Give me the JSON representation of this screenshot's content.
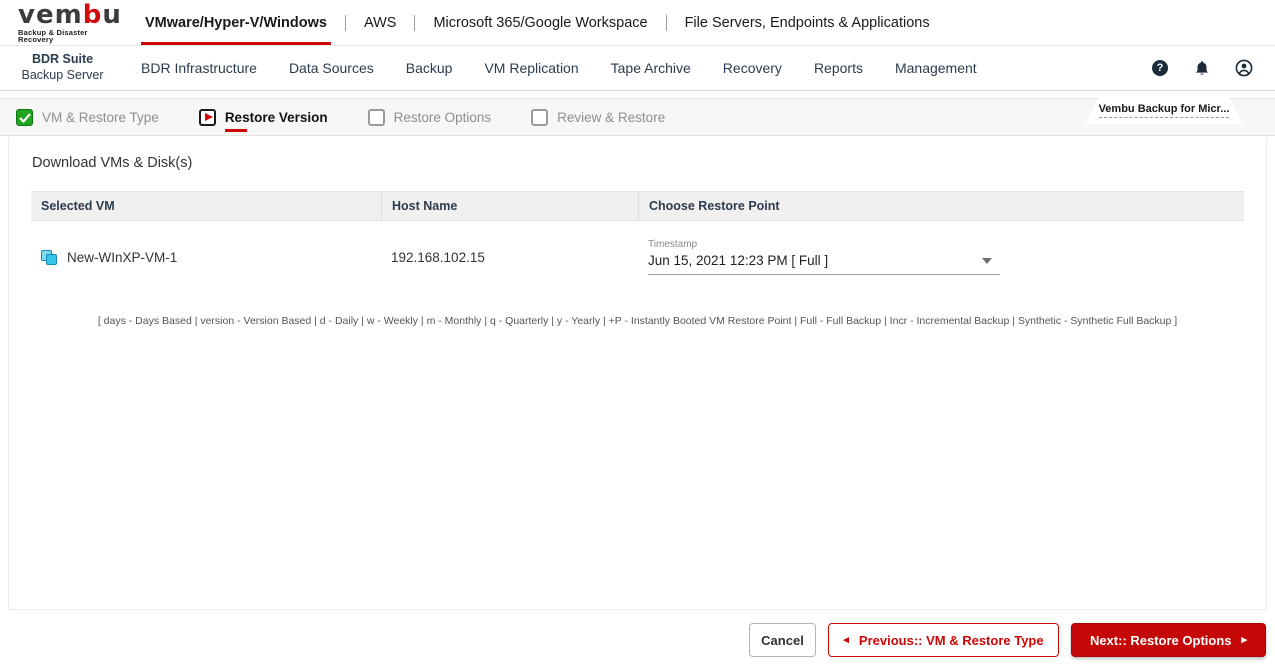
{
  "brand": {
    "logo_left": "vem",
    "logo_red": "b",
    "logo_right": "u",
    "tagline": "Backup & Disaster Recovery"
  },
  "top_nav": {
    "items": [
      {
        "label": "VMware/Hyper-V/Windows",
        "active": true
      },
      {
        "label": "AWS",
        "active": false
      },
      {
        "label": "Microsoft 365/Google Workspace",
        "active": false
      },
      {
        "label": "File Servers, Endpoints & Applications",
        "active": false
      }
    ]
  },
  "product": {
    "name": "BDR Suite",
    "subtitle": "Backup Server"
  },
  "main_nav": {
    "items": [
      {
        "label": "BDR Infrastructure"
      },
      {
        "label": "Data Sources"
      },
      {
        "label": "Backup"
      },
      {
        "label": "VM Replication"
      },
      {
        "label": "Tape Archive"
      },
      {
        "label": "Recovery"
      },
      {
        "label": "Reports"
      },
      {
        "label": "Management"
      }
    ]
  },
  "icons": {
    "help_glyph": "?",
    "prev_arrow": "◂",
    "next_arrow": "▸"
  },
  "wizard": {
    "steps": [
      {
        "label": "VM & Restore Type",
        "state": "done"
      },
      {
        "label": "Restore Version",
        "state": "current"
      },
      {
        "label": "Restore Options",
        "state": "pending"
      },
      {
        "label": "Review & Restore",
        "state": "pending"
      }
    ],
    "context_tab": "Vembu Backup for Micr..."
  },
  "content": {
    "title": "Download VMs & Disk(s)",
    "table": {
      "columns": [
        "Selected VM",
        "Host Name",
        "Choose Restore Point"
      ],
      "rows": [
        {
          "vm_name": "New-WInXP-VM-1",
          "host_name": "192.168.102.15",
          "restore_point_label": "Timestamp",
          "restore_point_value": "Jun 15, 2021 12:23 PM [ Full ]"
        }
      ]
    },
    "legend": "[ days - Days Based | version - Version Based | d - Daily | w - Weekly | m - Monthly | q - Quarterly | y - Yearly | +P - Instantly Booted VM Restore Point | Full - Full Backup | Incr - Incremental Backup | Synthetic - Synthetic Full Backup ]"
  },
  "footer": {
    "cancel_label": "Cancel",
    "previous_label": "Previous:: VM & Restore Type",
    "next_label": "Next:: Restore Options"
  },
  "colors": {
    "brand_red": "#cc0606",
    "navy": "#2b3c4e",
    "step_done_green": "#1fa51f",
    "header_bg": "#f0f0f0",
    "stepsbar_bg": "#f7f7f7"
  }
}
